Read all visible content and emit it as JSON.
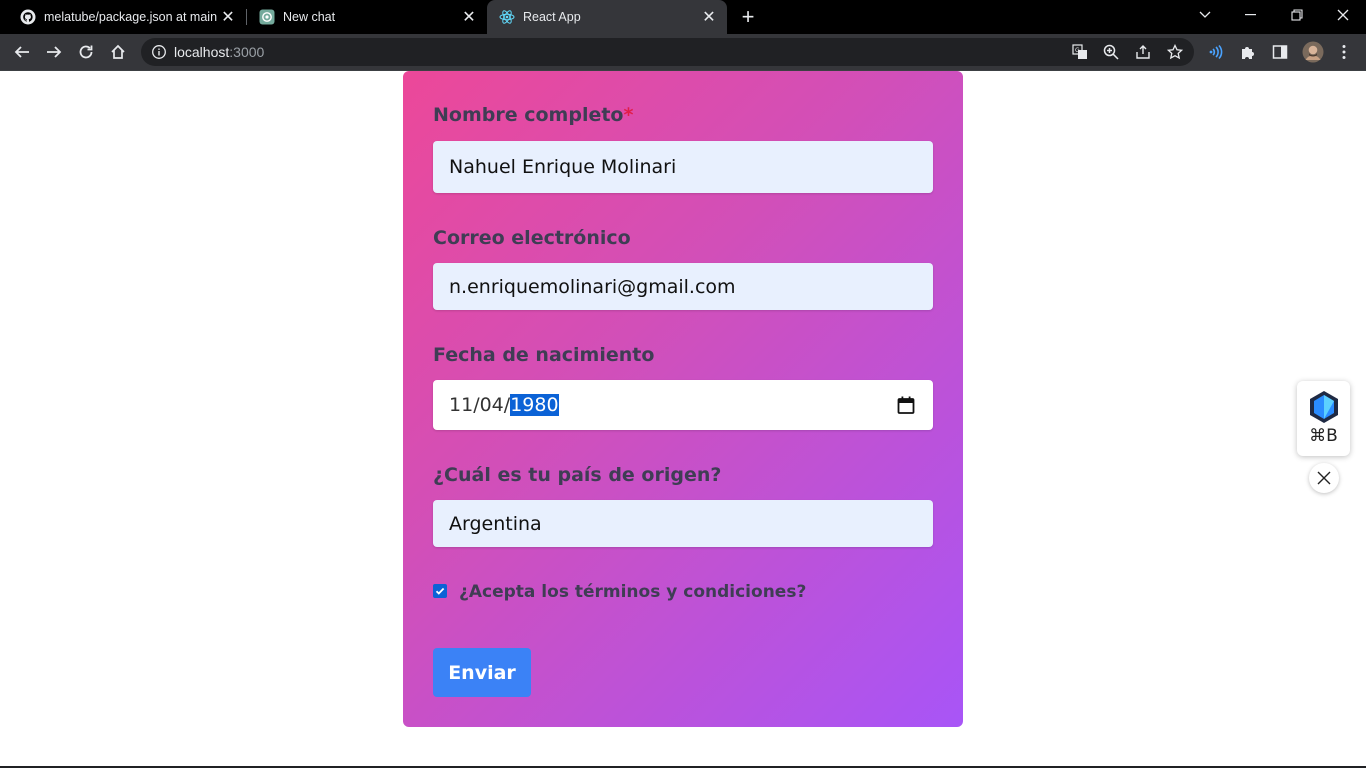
{
  "browser": {
    "tabs": [
      {
        "title": "melatube/package.json at main ·",
        "icon": "github-icon",
        "active": false
      },
      {
        "title": "New chat",
        "icon": "chatgpt-icon",
        "active": false
      },
      {
        "title": "React App",
        "icon": "react-icon",
        "active": true
      }
    ],
    "address": {
      "host": "localhost",
      "port": ":3000"
    }
  },
  "form": {
    "name_label": "Nombre completo",
    "name_required_mark": "*",
    "name_value": "Nahuel Enrique Molinari",
    "email_label": "Correo electrónico",
    "email_value": "n.enriquemolinari@gmail.com",
    "birth_label": "Fecha de nacimiento",
    "birth_day": "11",
    "birth_sep1": "/",
    "birth_month": "04",
    "birth_sep2": "/",
    "birth_year": "1980",
    "country_label": "¿Cuál es tu país de origen?",
    "country_value": "Argentina",
    "terms_label": "¿Acepta los términos y condiciones?",
    "terms_checked": true,
    "submit_label": "Enviar"
  },
  "widget": {
    "shortcut": "⌘B"
  },
  "colors": {
    "card_gradient_start": "#ec4899",
    "card_gradient_end": "#a855f7",
    "input_bg": "#e8f0fe",
    "submit_bg": "#3b82f6",
    "label_text": "#3f3d54",
    "required": "#e11d48"
  }
}
